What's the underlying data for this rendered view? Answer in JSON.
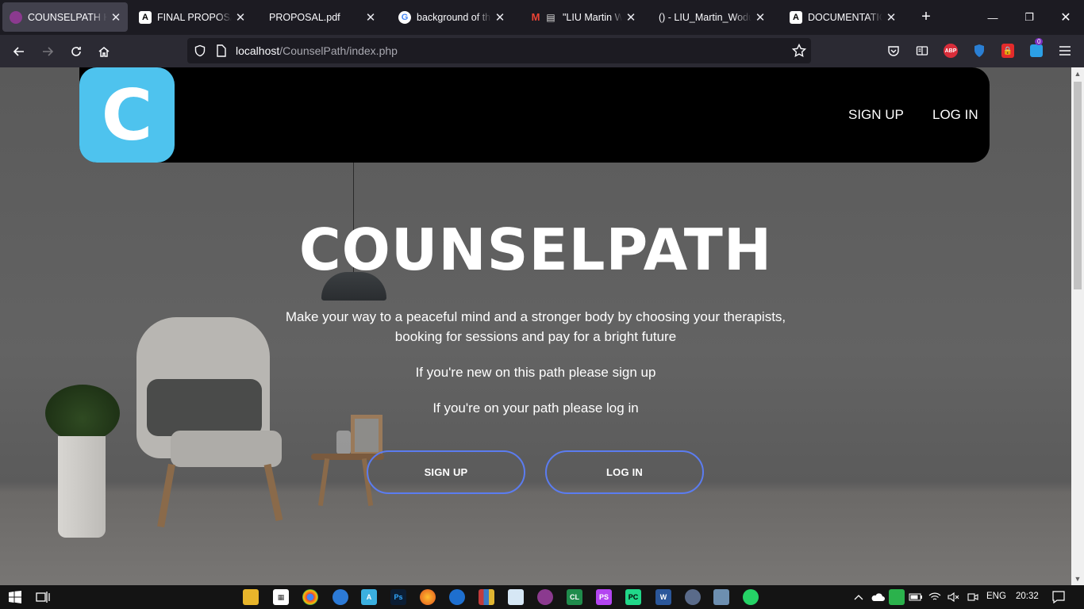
{
  "browser": {
    "tabs": [
      {
        "title": "COUNSELPATH HOME",
        "icon": "counselpath-favicon",
        "active": true
      },
      {
        "title": "FINAL PROPOSAL RE",
        "icon": "a-favicon",
        "active": false
      },
      {
        "title": "PROPOSAL.pdf",
        "icon": "",
        "active": false
      },
      {
        "title": "background of the s",
        "icon": "google-favicon",
        "active": false
      },
      {
        "title": "\"LIU Martin Wodulo",
        "icon": "gmail-favicon",
        "active": false
      },
      {
        "title": "() - LIU_Martin_Wodulo_",
        "icon": "",
        "active": false
      },
      {
        "title": "DOCUMENTATION C",
        "icon": "a-favicon",
        "active": false
      }
    ],
    "url_host": "localhost",
    "url_path": "/CounselPath/index.php",
    "notification_count": "0"
  },
  "site": {
    "logo_letter": "C",
    "nav": {
      "sign_up": "SIGN UP",
      "log_in": "LOG IN"
    },
    "hero": {
      "title": "COUNSELPATH",
      "line1": "Make your way to a peaceful mind and a stronger body by choosing your therapists,",
      "line2": "booking for sessions and pay for a bright future",
      "line3": "If you're new on this path please sign up",
      "line4": "If you're on your path please log in"
    },
    "buttons": {
      "sign_up": "SIGN UP",
      "log_in": "LOG IN"
    },
    "accent_color": "#4ec3ee",
    "button_border_color": "#5b7cf0"
  },
  "taskbar": {
    "language": "ENG",
    "time": "20:32"
  }
}
